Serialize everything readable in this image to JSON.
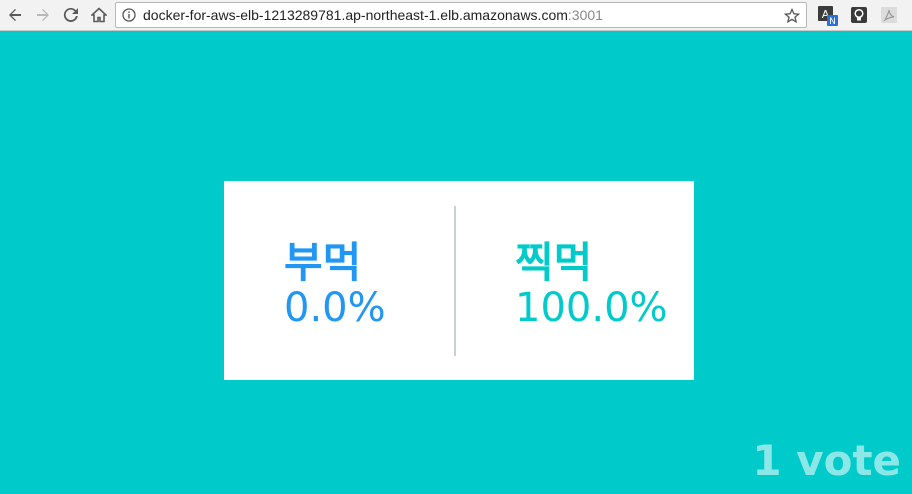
{
  "browser": {
    "url_main": "docker-for-aws-elb-1213289781.ap-northeast-1.elb.amazonaws.com",
    "url_port": ":3001",
    "icons": [
      "back-icon",
      "forward-icon",
      "reload-icon",
      "home-icon",
      "info-icon",
      "star-icon",
      "translate-extension-icon",
      "lightbulb-extension-icon",
      "pdf-extension-icon"
    ]
  },
  "poll": {
    "option_a": {
      "name": "부먹",
      "percent": "0.0%",
      "color": "#2196f3"
    },
    "option_b": {
      "name": "찍먹",
      "percent": "100.0%",
      "color": "#00cbca"
    },
    "vote_count": "1 vote"
  },
  "colors": {
    "background": "#00cbca",
    "card": "#ffffff"
  }
}
